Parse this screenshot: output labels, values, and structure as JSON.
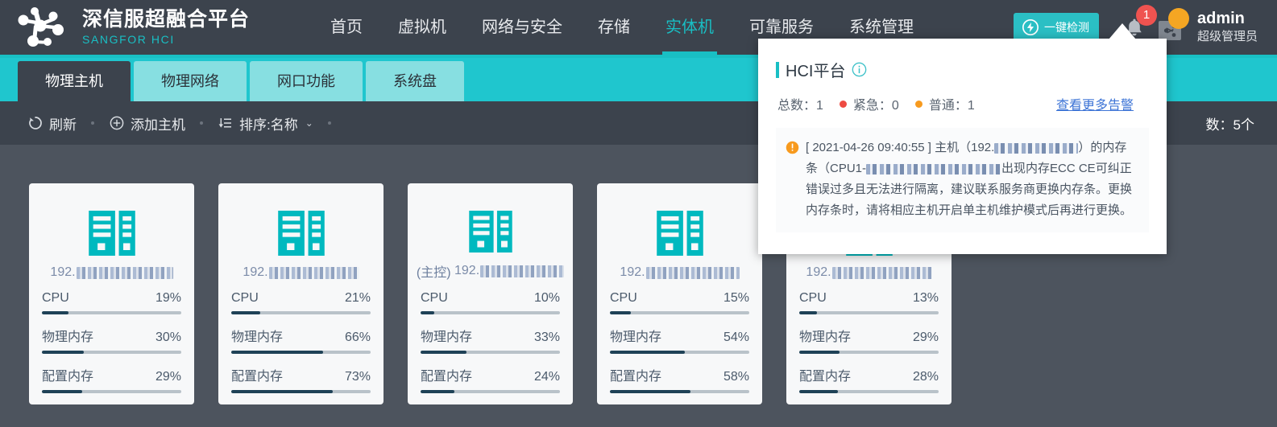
{
  "brand": {
    "name_cn": "深信服超融合平台",
    "name_en": "SANGFOR HCI",
    "logo_icon": "molecule-logo-icon"
  },
  "nav": {
    "items": [
      {
        "label": "首页",
        "active": false
      },
      {
        "label": "虚拟机",
        "active": false
      },
      {
        "label": "网络与安全",
        "active": false
      },
      {
        "label": "存储",
        "active": false
      },
      {
        "label": "实体机",
        "active": true
      },
      {
        "label": "可靠服务",
        "active": false
      },
      {
        "label": "系统管理",
        "active": false
      }
    ]
  },
  "header_right": {
    "scan_button": {
      "label": "一键检测",
      "icon": "lightning-circle-icon",
      "color": "#2bbfc4"
    },
    "bell": {
      "icon": "bell-icon",
      "badge_count": "1",
      "badge_color": "#ef5350"
    },
    "share": {
      "icon": "share-icon",
      "status_color": "#f5a623"
    },
    "admin_name": "admin",
    "admin_role": "超级管理员"
  },
  "tabs": [
    {
      "label": "物理主机",
      "active": true
    },
    {
      "label": "物理网络",
      "active": false
    },
    {
      "label": "网口功能",
      "active": false
    },
    {
      "label": "系统盘",
      "active": false
    }
  ],
  "toolbar": {
    "refresh": {
      "label": "刷新",
      "icon": "refresh-icon"
    },
    "add_host": {
      "label": "添加主机",
      "icon": "plus-circle-icon"
    },
    "sort": {
      "label": "排序:名称",
      "icon": "sort-icon",
      "caret": "⌄"
    },
    "count_text": "数：5个"
  },
  "hosts": [
    {
      "ip_prefix": "192.",
      "ip_redacted_width": 120,
      "is_master": false,
      "master_label": "",
      "icon": "server-icon",
      "metrics": [
        {
          "label": "CPU",
          "value": "19%",
          "pct": 19
        },
        {
          "label": "物理内存",
          "value": "30%",
          "pct": 30
        },
        {
          "label": "配置内存",
          "value": "29%",
          "pct": 29
        }
      ]
    },
    {
      "ip_prefix": "192.",
      "ip_redacted_width": 112,
      "is_master": false,
      "master_label": "",
      "icon": "server-icon",
      "metrics": [
        {
          "label": "CPU",
          "value": "21%",
          "pct": 21
        },
        {
          "label": "物理内存",
          "value": "66%",
          "pct": 66
        },
        {
          "label": "配置内存",
          "value": "73%",
          "pct": 73
        }
      ]
    },
    {
      "ip_prefix": "192.",
      "ip_redacted_width": 104,
      "is_master": true,
      "master_label": "(主控)",
      "icon": "server-icon",
      "metrics": [
        {
          "label": "CPU",
          "value": "10%",
          "pct": 10
        },
        {
          "label": "物理内存",
          "value": "33%",
          "pct": 33
        },
        {
          "label": "配置内存",
          "value": "24%",
          "pct": 24
        }
      ]
    },
    {
      "ip_prefix": "192.",
      "ip_redacted_width": 116,
      "is_master": false,
      "master_label": "",
      "icon": "server-icon",
      "metrics": [
        {
          "label": "CPU",
          "value": "15%",
          "pct": 15
        },
        {
          "label": "物理内存",
          "value": "54%",
          "pct": 54
        },
        {
          "label": "配置内存",
          "value": "58%",
          "pct": 58
        }
      ]
    },
    {
      "ip_prefix": "192.",
      "ip_redacted_width": 124,
      "is_master": false,
      "master_label": "",
      "icon": "server-icon",
      "metrics": [
        {
          "label": "CPU",
          "value": "13%",
          "pct": 13
        },
        {
          "label": "物理内存",
          "value": "29%",
          "pct": 29
        },
        {
          "label": "配置内存",
          "value": "28%",
          "pct": 28
        }
      ]
    }
  ],
  "alert_popup": {
    "title": "HCI平台",
    "info_icon": "info-circle-icon",
    "total_label": "总数：1",
    "urgent_label": "紧急：0",
    "normal_label": "普通：1",
    "urgent_dot_color": "#ee4b42",
    "normal_dot_color": "#f79a1e",
    "more_link": "查看更多告警",
    "alert": {
      "icon": "warning-icon",
      "text_part1": "[ 2021-04-26 09:40:55 ] 主机（192.",
      "text_part2": "）的内存条（CPU1-",
      "text_part3": "出现内存ECC CE可纠正错误过多且无法进行隔离，建议联系服务商更换内存条。更换内存条时，请将相应主机开启单主机维护模式后再进行更换。"
    }
  }
}
